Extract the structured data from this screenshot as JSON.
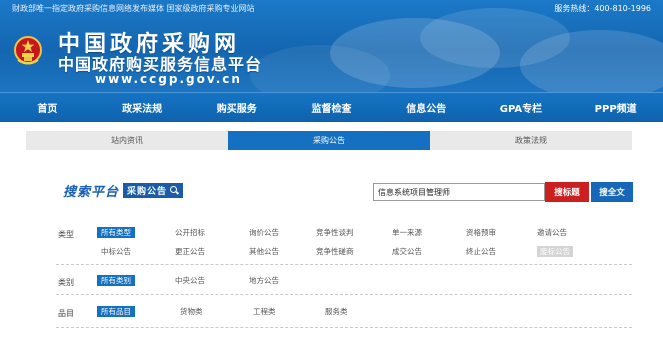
{
  "header": {
    "notice": "财政部唯一指定政府采购信息网络发布媒体 国家级政府采购专业网站",
    "hotline": "服务热线：400-810-1996",
    "title": "中国政府采购网",
    "subtitle": "中国政府购买服务信息平台",
    "url": "www.ccgp.gov.cn",
    "emblem_icon": "national-emblem-icon",
    "colors": {
      "banner": "#1466b0",
      "nav": "#0f62ad"
    }
  },
  "nav": {
    "items": [
      "首页",
      "政采法规",
      "购买服务",
      "监督检查",
      "信息公告",
      "GPA专栏",
      "PPP频道"
    ]
  },
  "sub_tabs": {
    "items": [
      "站内资讯",
      "采购公告",
      "政策法规"
    ],
    "active": "采购公告"
  },
  "search": {
    "logo_text": "搜索平台",
    "logo_tag": "采购公告",
    "logo_icon": "search-icon",
    "query": "信息系统项目管理师",
    "btn_title": "搜标题",
    "btn_full": "搜全文",
    "colors": {
      "btn_title": "#cc1f1f",
      "btn_full": "#1667b8"
    }
  },
  "filters": {
    "type": {
      "label": "类型",
      "row1": [
        "所有类型",
        "公开招标",
        "询价公告",
        "竞争性谈判",
        "单一来源",
        "资格预审",
        "邀请公告"
      ],
      "row2": [
        "中标公告",
        "更正公告",
        "其他公告",
        "竞争性磋商",
        "成交公告",
        "终止公告",
        "废标公告"
      ],
      "active": "所有类型",
      "disabled": "废标公告"
    },
    "category": {
      "label": "类别",
      "options": [
        "所有类别",
        "中央公告",
        "地方公告"
      ],
      "active": "所有类别"
    },
    "item": {
      "label": "品目",
      "options": [
        "所有品目",
        "货物类",
        "工程类",
        "服务类"
      ],
      "active": "所有品目"
    }
  }
}
